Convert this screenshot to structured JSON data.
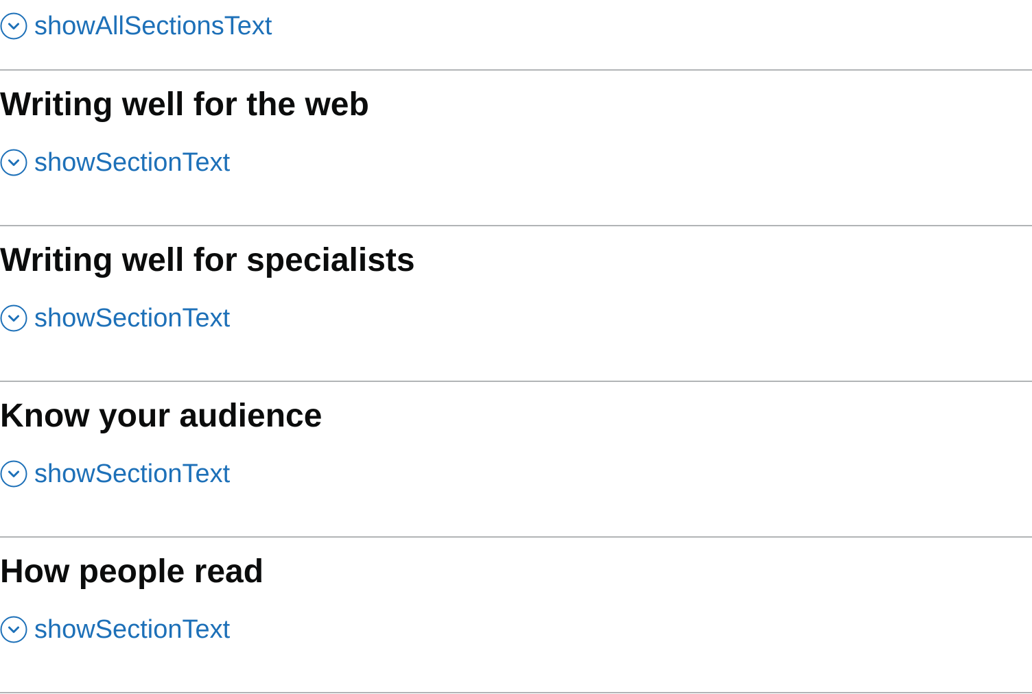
{
  "accordion": {
    "show_all_label": "showAllSectionsText",
    "sections": [
      {
        "heading": "Writing well for the web",
        "toggle_label": "showSectionText"
      },
      {
        "heading": "Writing well for specialists",
        "toggle_label": "showSectionText"
      },
      {
        "heading": "Know your audience",
        "toggle_label": "showSectionText"
      },
      {
        "heading": "How people read",
        "toggle_label": "showSectionText"
      }
    ]
  },
  "icons": {
    "toggle": "chevron-down-circle-icon"
  },
  "colors": {
    "link": "#1d70b8",
    "text": "#0b0c0c",
    "divider": "#b1b4b6"
  }
}
